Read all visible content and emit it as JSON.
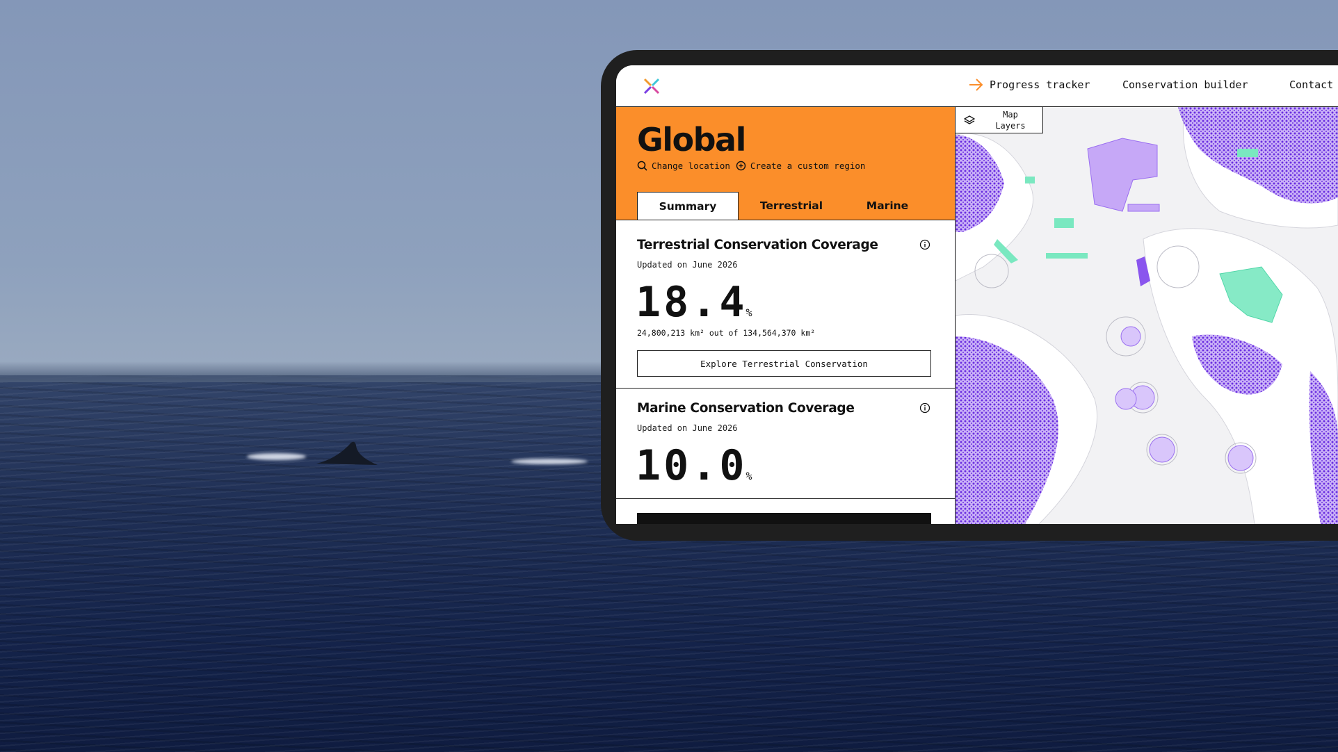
{
  "nav": {
    "items": [
      "Progress tracker",
      "Conservation builder",
      "Contact"
    ]
  },
  "hero": {
    "title": "Global",
    "change_location": "Change location",
    "create_region": "Create a custom region",
    "tabs": [
      "Summary",
      "Terrestrial",
      "Marine"
    ],
    "active_tab": "Summary"
  },
  "terrestrial": {
    "title": "Terrestrial Conservation Coverage",
    "updated": "Updated on June 2026",
    "value": "18.4",
    "unit": "%",
    "area_text": "24,800,213 km² out of 134,564,370 km²",
    "button": "Explore Terrestrial Conservation"
  },
  "marine": {
    "title": "Marine Conservation Coverage",
    "updated": "Updated on June 2026",
    "value": "10.0",
    "unit": "%"
  },
  "map": {
    "layers_label": "Map Layers"
  },
  "colors": {
    "accent_orange": "#fb8e2a",
    "protected_purple": "#7b3fe4",
    "marine_green": "#4fe0a8"
  }
}
